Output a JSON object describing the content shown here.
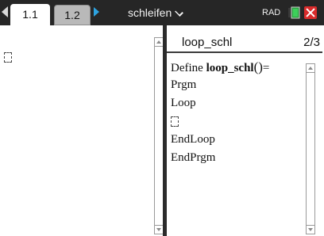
{
  "tabs": [
    {
      "label": "1.1",
      "active": true
    },
    {
      "label": "1.2",
      "active": false
    }
  ],
  "document": {
    "title": "schleifen"
  },
  "status": {
    "angle_mode": "RAD"
  },
  "editor": {
    "program_name": "loop_schl",
    "page_indicator": "2/3",
    "lines": {
      "define_keyword": "Define ",
      "function_name": "loop_schl",
      "parens": "()",
      "equals": "=",
      "prgm": "Prgm",
      "loop": "Loop",
      "endloop": "EndLoop",
      "endprgm": "EndPrgm"
    }
  },
  "colors": {
    "top_bar": "#262626",
    "nav_arrow": "#2da3e0",
    "close_button": "#d92b2b",
    "battery": "#2ea043"
  },
  "icons": [
    "left-arrow-icon",
    "right-arrow-icon",
    "chevron-down-icon",
    "battery-icon",
    "close-icon",
    "scroll-up-icon",
    "scroll-down-icon"
  ]
}
